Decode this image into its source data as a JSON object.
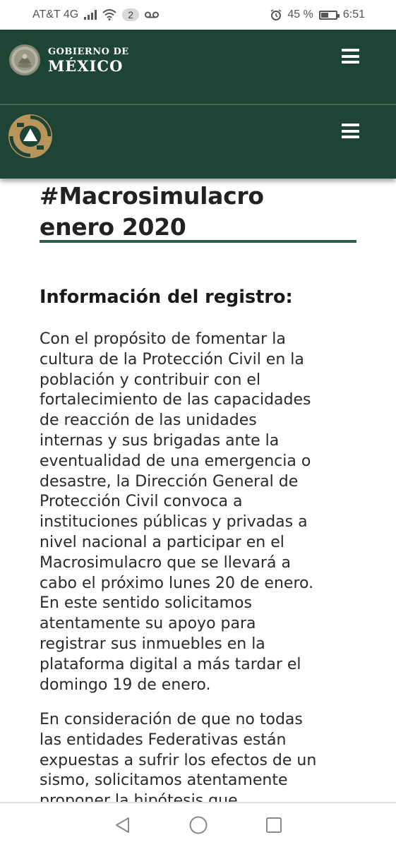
{
  "status_bar": {
    "carrier": "AT&T 4G",
    "sim_badge": "2",
    "battery": "45 %",
    "battery_level": 0.45,
    "time": "6:51",
    "icons": [
      "signal-icon",
      "wifi-icon",
      "voicemail-icon",
      "alarm-icon",
      "battery-icon"
    ]
  },
  "gov_header": {
    "line1": "GOBIERNO DE",
    "line2": "MÉXICO",
    "color": "#1e4436"
  },
  "article": {
    "title_line1": "#Macrosimulacro",
    "title_line2": "enero 2020",
    "subtitle": "Información del registro:",
    "paragraph1": "Con el propósito de fomentar la\ncultura de la Protección Civil en la\npoblación y contribuir con el\nfortalecimiento de las capacidades\nde reacción de las unidades\ninternas y sus brigadas ante la\neventualidad de una emergencia o\ndesastre, la Dirección General de\nProtección Civil convoca a\ninstituciones públicas y privadas a\nnivel nacional a participar en el\nMacrosimulacro que se llevará a\ncabo el próximo lunes 20 de enero.\nEn este sentido solicitamos\natentamente su apoyo para\nregistrar sus inmuebles en la\nplataforma digital a más tardar el\ndomingo 19 de enero.",
    "paragraph2": "En consideración de que no todas\nlas entidades Federativas están\nexpuestas a sufrir los efectos de un\nsismo, solicitamos atentamente\nproponer la hipótesis que"
  },
  "colors": {
    "header_green": "#1e4436",
    "rule_green": "#2e5d4b",
    "pc_gold": "#b8955a"
  }
}
